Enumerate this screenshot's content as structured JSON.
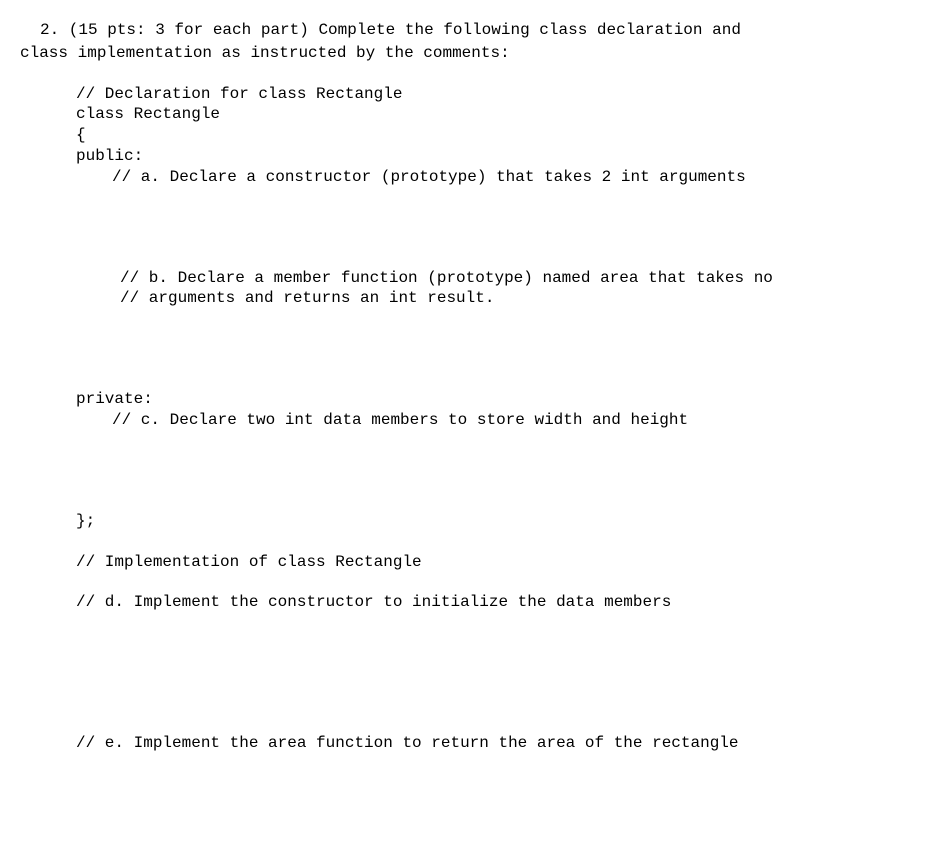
{
  "question": {
    "number_prefix": "2. (15 pts: 3 for each part) Complete the following class declaration and",
    "header_cont": "class implementation as instructed by the comments:"
  },
  "code": {
    "decl_comment": "// Declaration for class Rectangle",
    "class_line": "class Rectangle",
    "open_brace": "{",
    "public_label": "public:",
    "part_a": "// a. Declare a constructor (prototype) that takes 2 int arguments",
    "part_b_line1": "// b. Declare a member function (prototype) named area that takes no",
    "part_b_line2": "//    arguments and returns an int result.",
    "private_label": "private:",
    "part_c": "// c. Declare two int data members to store width and height",
    "close_brace": "};",
    "impl_comment": "// Implementation of class Rectangle",
    "part_d": "// d. Implement the constructor to initialize the data members",
    "part_e": "// e. Implement the area function to return the area of the rectangle"
  }
}
